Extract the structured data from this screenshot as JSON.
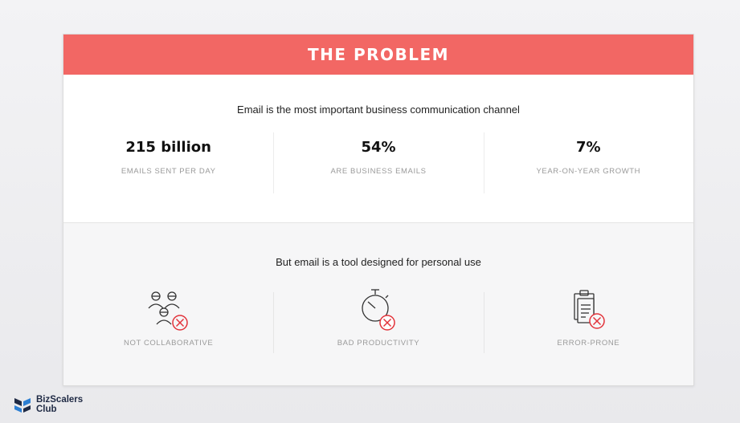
{
  "slide": {
    "title": "THE PROBLEM",
    "subtitle_top": "Email is the most important business communication channel",
    "stats": [
      {
        "value": "215 billion",
        "label": "EMAILS SENT PER DAY"
      },
      {
        "value": "54%",
        "label": "ARE BUSINESS EMAILS"
      },
      {
        "value": "7%",
        "label": "YEAR-ON-YEAR GROWTH"
      }
    ],
    "subtitle_bottom": "But email is a tool designed for personal use",
    "problems": [
      {
        "icon": "people-x-icon",
        "label": "NOT COLLABORATIVE"
      },
      {
        "icon": "stopwatch-x-icon",
        "label": "BAD PRODUCTIVITY"
      },
      {
        "icon": "clipboard-x-icon",
        "label": "ERROR-PRONE"
      }
    ]
  },
  "logo": {
    "line1": "BizScalers",
    "line2": "Club"
  },
  "colors": {
    "accent": "#f26764",
    "logo_navy": "#1f2a44",
    "logo_blue": "#2d7fd3"
  }
}
